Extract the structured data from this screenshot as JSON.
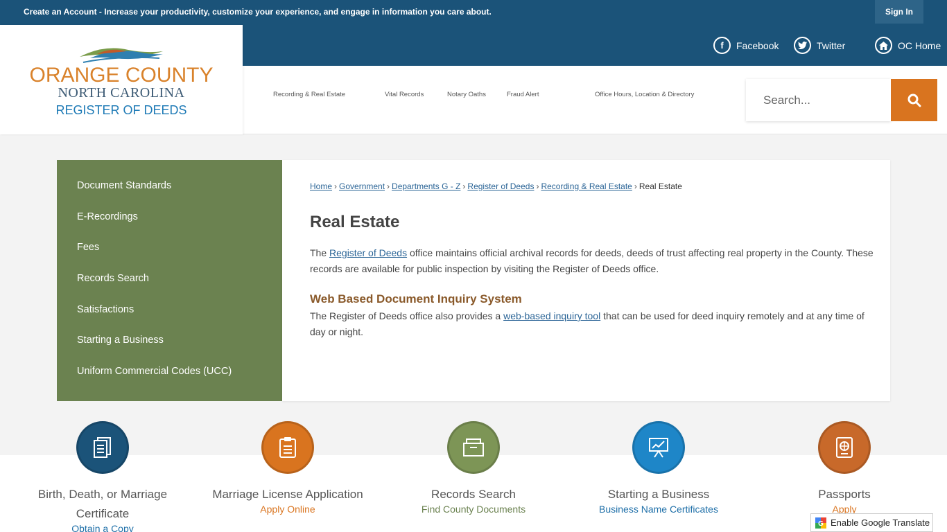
{
  "topbar": {
    "message_bold": "Create an Account",
    "message_rest": " - Increase your productivity, customize your experience, and engage in information you care about.",
    "signin_label": "Sign In"
  },
  "logo": {
    "line1": "ORANGE COUNTY",
    "line2": "NORTH CAROLINA",
    "line3": "REGISTER OF DEEDS"
  },
  "social": [
    {
      "label": "Facebook",
      "icon": "facebook-icon"
    },
    {
      "label": "Twitter",
      "icon": "twitter-icon"
    },
    {
      "label": "OC Home",
      "icon": "home-icon"
    }
  ],
  "nav": [
    "Recording & Real Estate",
    "Vital Records",
    "Notary Oaths",
    "Fraud Alert",
    "Office Hours, Location & Directory"
  ],
  "search": {
    "placeholder": "Search..."
  },
  "sidebar": {
    "items": [
      "Document Standards",
      "E-Recordings",
      "Fees",
      "Records Search",
      "Satisfactions",
      "Starting a Business",
      "Uniform Commercial Codes (UCC)"
    ]
  },
  "breadcrumb": {
    "links": [
      "Home",
      "Government",
      "Departments G - Z",
      "Register of Deeds",
      "Recording & Real Estate"
    ],
    "current": "Real Estate",
    "separator": "›"
  },
  "main": {
    "title": "Real Estate",
    "p1_before": "The ",
    "p1_link": "Register of Deeds",
    "p1_after": " office maintains official archival records for deeds, deeds of trust affecting real property in the County. These records are available for public inspection by visiting the Register of Deeds office.",
    "subheading": "Web Based Document Inquiry System",
    "p2_before": "The Register of Deeds office also provides a ",
    "p2_link": "web-based inquiry tool",
    "p2_after": " that can be used for deed inquiry remotely and at any time of day or night."
  },
  "quicklinks": [
    {
      "title": "Birth, Death, or Marriage Certificate",
      "sub": "Obtain a Copy",
      "color": "#1b5379",
      "sub_color": "#1e6fa8",
      "icon": "document-icon"
    },
    {
      "title": "Marriage License Application",
      "sub": "Apply Online",
      "color": "#d9741f",
      "sub_color": "#d9741f",
      "icon": "clipboard-icon"
    },
    {
      "title": "Records Search",
      "sub": "Find County Documents",
      "color": "#7d9556",
      "sub_color": "#6b8250",
      "icon": "folder-icon"
    },
    {
      "title": "Starting a Business",
      "sub": "Business Name Certificates",
      "color": "#1e86c8",
      "sub_color": "#1e6fa8",
      "icon": "presentation-icon"
    },
    {
      "title": "Passports",
      "sub": "Apply",
      "color": "#c8692a",
      "sub_color": "#d9741f",
      "icon": "passport-icon"
    }
  ],
  "translate": {
    "label": "Enable Google Translate"
  },
  "colors": {
    "header_blue": "#1b5379",
    "accent_orange": "#d9741f",
    "sidebar_green": "#6b8250"
  }
}
